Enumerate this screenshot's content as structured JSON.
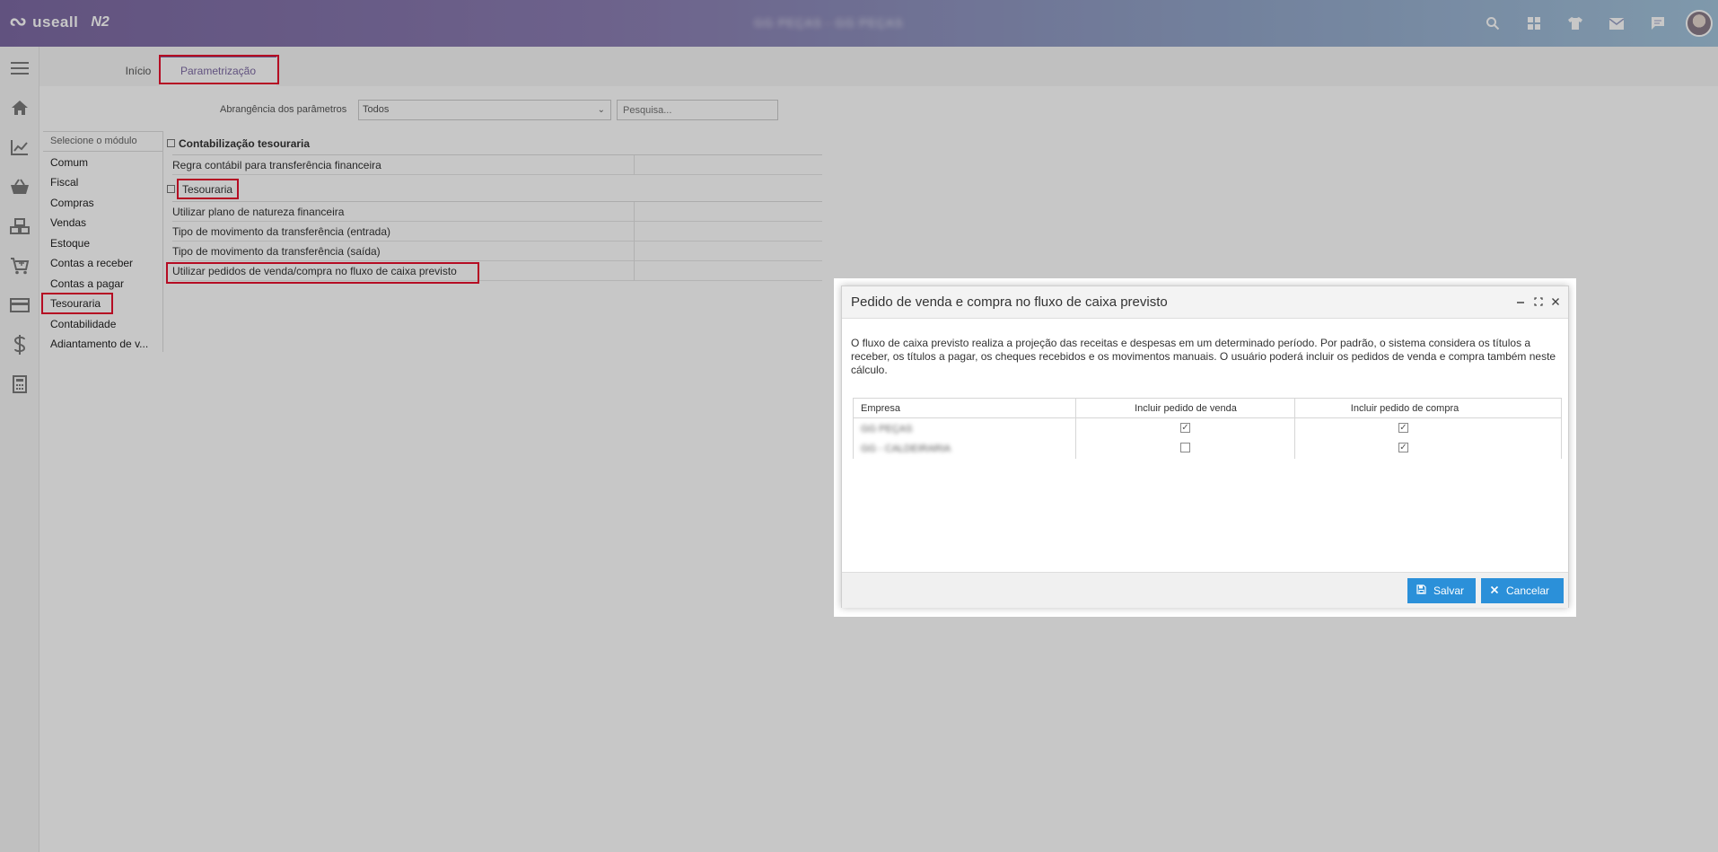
{
  "topbar": {
    "logo_mark": "∾",
    "logo_text": "useall",
    "logo_version": "N2",
    "company": "GG PEÇAS - GG PEÇAS",
    "icons": [
      "search-icon",
      "apps-icon",
      "shirt-icon",
      "mail-icon",
      "chat-icon"
    ]
  },
  "rail": {
    "icons": [
      "menu-icon",
      "home-icon",
      "chart-icon",
      "basket-icon",
      "boxes-icon",
      "cart-icon",
      "card-icon",
      "dollar-icon",
      "calculator-icon"
    ]
  },
  "tabs": {
    "inicio": "Início",
    "parametrizacao": "Parametrização"
  },
  "filter": {
    "label": "Abrangência dos parâmetros",
    "select_value": "Todos",
    "search_placeholder": "Pesquisa..."
  },
  "modules": {
    "header": "Selecione o módulo",
    "items": [
      "Comum",
      "Fiscal",
      "Compras",
      "Vendas",
      "Estoque",
      "Contas a receber",
      "Contas a pagar",
      "Tesouraria",
      "Contabilidade",
      "Adiantamento de v..."
    ]
  },
  "params": {
    "group1": {
      "title": "Contabilização tesouraria",
      "rows": [
        "Regra contábil para transferência financeira"
      ]
    },
    "group2": {
      "title": "Tesouraria",
      "rows": [
        "Utilizar plano de natureza financeira",
        "Tipo de movimento da transferência (entrada)",
        "Tipo de movimento da transferência (saída)",
        "Utilizar pedidos de venda/compra no fluxo de caixa previsto"
      ]
    }
  },
  "modal": {
    "title": "Pedido de venda e compra no fluxo de caixa previsto",
    "description": "O fluxo de caixa previsto realiza a projeção das receitas e despesas em um determinado período. Por padrão, o sistema considera os títulos a receber, os títulos a pagar, os cheques recebidos e os movimentos manuais. O usuário poderá incluir os pedidos de venda e compra também neste cálculo.",
    "columns": {
      "empresa": "Empresa",
      "venda": "Incluir pedido de venda",
      "compra": "Incluir pedido de compra"
    },
    "rows": [
      {
        "empresa": "GG PEÇAS",
        "venda": "✓",
        "compra": "✓"
      },
      {
        "empresa": "GG - CALDEIRARIA",
        "venda": "",
        "compra": "✓"
      }
    ],
    "buttons": {
      "save": "Salvar",
      "cancel": "Cancelar"
    }
  },
  "colors": {
    "accent": "#2b90d9",
    "highlight": "#e8102e",
    "brand": "#7d6aa3"
  }
}
